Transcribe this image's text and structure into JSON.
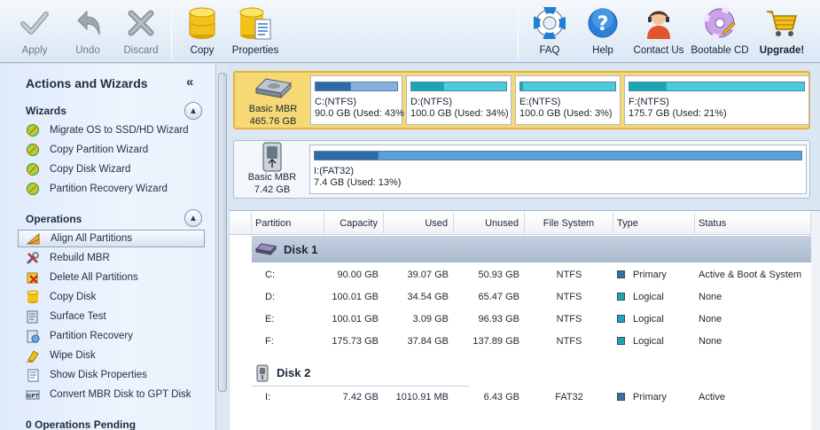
{
  "toolbar": {
    "left": [
      {
        "label": "Apply",
        "icon": "checkmark-icon",
        "disabled": true
      },
      {
        "label": "Undo",
        "icon": "undo-arrow-icon",
        "disabled": true
      },
      {
        "label": "Discard",
        "icon": "x-icon",
        "disabled": true
      },
      {
        "label": "Copy",
        "icon": "database-copy-icon",
        "disabled": false
      },
      {
        "label": "Properties",
        "icon": "database-properties-icon",
        "disabled": false
      }
    ],
    "right": [
      {
        "label": "FAQ",
        "icon": "lifebuoy-icon"
      },
      {
        "label": "Help",
        "icon": "help-icon"
      },
      {
        "label": "Contact Us",
        "icon": "support-agent-icon"
      },
      {
        "label": "Bootable CD",
        "icon": "cd-icon"
      },
      {
        "label": "Upgrade!",
        "icon": "cart-icon"
      }
    ]
  },
  "left_panel": {
    "title": "Actions and Wizards",
    "collapse_glyph": "«",
    "wizards": {
      "heading": "Wizards",
      "items": [
        {
          "label": "Migrate OS to SSD/HD Wizard",
          "icon": "wizard-icon"
        },
        {
          "label": "Copy Partition Wizard",
          "icon": "wizard-icon"
        },
        {
          "label": "Copy Disk Wizard",
          "icon": "wizard-icon"
        },
        {
          "label": "Partition Recovery Wizard",
          "icon": "wizard-icon"
        }
      ]
    },
    "operations": {
      "heading": "Operations",
      "items": [
        {
          "label": "Align All Partitions",
          "icon": "align-icon",
          "selected": true
        },
        {
          "label": "Rebuild MBR",
          "icon": "tools-icon"
        },
        {
          "label": "Delete All Partitions",
          "icon": "delete-icon"
        },
        {
          "label": "Copy Disk",
          "icon": "copy-disk-icon"
        },
        {
          "label": "Surface Test",
          "icon": "surface-test-icon"
        },
        {
          "label": "Partition Recovery",
          "icon": "partition-recovery-icon"
        },
        {
          "label": "Wipe Disk",
          "icon": "wipe-icon"
        },
        {
          "label": "Show Disk Properties",
          "icon": "properties-icon"
        },
        {
          "label": "Convert MBR Disk to GPT Disk",
          "icon": "convert-icon"
        }
      ]
    },
    "pending": "0 Operations Pending"
  },
  "disk_map": [
    {
      "name": "Basic MBR",
      "size": "465.76 GB",
      "selected": true,
      "icon": "hard-drive-icon",
      "partitions": [
        {
          "name": "C:(NTFS)",
          "info": "90.0 GB (Used: 43%",
          "used_fraction": 0.43,
          "color": "#2f6aa8"
        },
        {
          "name": "D:(NTFS)",
          "info": "100.0 GB (Used: 34%)",
          "used_fraction": 0.34,
          "color": "#17a7b6"
        },
        {
          "name": "E:(NTFS)",
          "info": "100.0 GB (Used: 3%)",
          "used_fraction": 0.03,
          "color": "#17a7b6"
        },
        {
          "name": "F:(NTFS)",
          "info": "175.7 GB (Used: 21%)",
          "used_fraction": 0.21,
          "color": "#17a7b6"
        }
      ]
    },
    {
      "name": "Basic MBR",
      "size": "7.42 GB",
      "selected": false,
      "icon": "usb-drive-icon",
      "partitions": [
        {
          "name": "I:(FAT32)",
          "info": "7.4 GB (Used: 13%)",
          "used_fraction": 0.13,
          "color": "#2f6aa8"
        }
      ]
    }
  ],
  "table": {
    "columns": [
      "Partition",
      "Capacity",
      "Used",
      "Unused",
      "File System",
      "Type",
      "Status"
    ],
    "groups": [
      {
        "name": "Disk 1",
        "selected": true,
        "icon": "disk-icon",
        "rows": [
          {
            "partition": "C:",
            "capacity": "90.00 GB",
            "used": "39.07 GB",
            "unused": "50.93 GB",
            "fs": "NTFS",
            "type": "Primary",
            "type_color": "#3c6ea6",
            "status": "Active & Boot & System"
          },
          {
            "partition": "D:",
            "capacity": "100.01 GB",
            "used": "34.54 GB",
            "unused": "65.47 GB",
            "fs": "NTFS",
            "type": "Logical",
            "type_color": "#1aa6b6",
            "status": "None"
          },
          {
            "partition": "E:",
            "capacity": "100.01 GB",
            "used": "3.09 GB",
            "unused": "96.93 GB",
            "fs": "NTFS",
            "type": "Logical",
            "type_color": "#1aa6b6",
            "status": "None"
          },
          {
            "partition": "F:",
            "capacity": "175.73 GB",
            "used": "37.84 GB",
            "unused": "137.89 GB",
            "fs": "NTFS",
            "type": "Logical",
            "type_color": "#1aa6b6",
            "status": "None"
          }
        ]
      },
      {
        "name": "Disk 2",
        "selected": false,
        "icon": "usb-disk-icon",
        "rows": [
          {
            "partition": "I:",
            "capacity": "7.42 GB",
            "used": "1010.91 MB",
            "unused": "6.43 GB",
            "fs": "FAT32",
            "type": "Primary",
            "type_color": "#3c6ea6",
            "status": "Active"
          }
        ]
      }
    ]
  }
}
